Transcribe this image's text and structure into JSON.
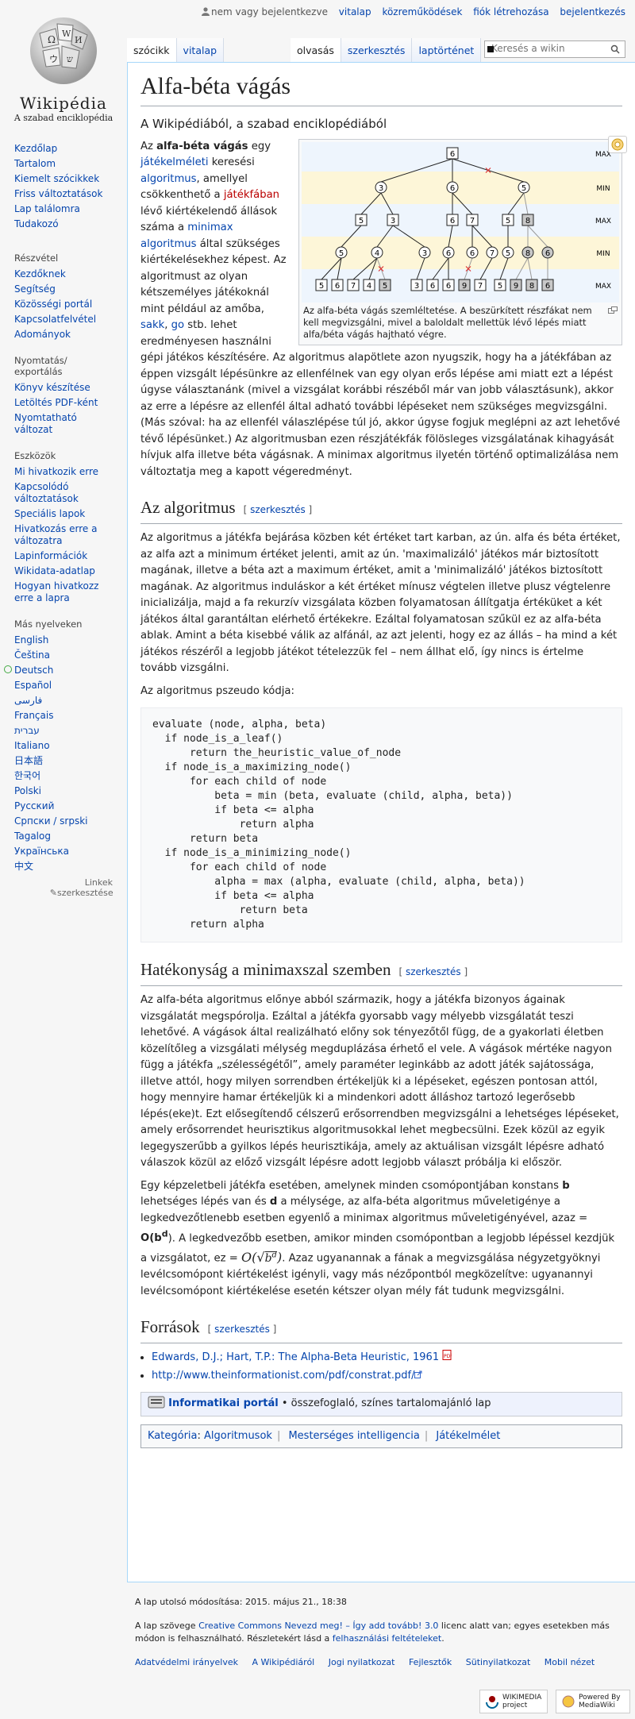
{
  "personal": {
    "not_logged_in": "nem vagy bejelentkezve",
    "talk": "vitalap",
    "contributions": "közreműködések",
    "create_account": "fiók létrehozása",
    "login": "bejelentkezés"
  },
  "logo": {
    "wordmark": "Wikipédia",
    "tagline": "A szabad enciklopédia"
  },
  "tabs": {
    "article": "szócikk",
    "talk": "vitalap",
    "read": "olvasás",
    "edit": "szerkesztés",
    "history": "laptörténet"
  },
  "search": {
    "placeholder": "Keresés a wikin"
  },
  "sidebar": {
    "nav": [
      "Kezdőlap",
      "Tartalom",
      "Kiemelt szócikkek",
      "Friss változtatások",
      "Lap találomra",
      "Tudakozó"
    ],
    "participate_heading": "Részvétel",
    "participate": [
      "Kezdőknek",
      "Segítség",
      "Közösségi portál",
      "Kapcsolatfelvétel",
      "Adományok"
    ],
    "print_heading": "Nyomtatás/ exportálás",
    "print": [
      "Könyv készítése",
      "Letöltés PDF-ként",
      "Nyomtatható változat"
    ],
    "tools_heading": "Eszközök",
    "tools": [
      "Mi hivatkozik erre",
      "Kapcsolódó változtatások",
      "Speciális lapok",
      "Hivatkozás erre a változatra",
      "Lapinformációk",
      "Wikidata-adatlap",
      "Hogyan hivatkozz erre a lapra"
    ],
    "lang_heading": "Más nyelveken",
    "languages": [
      "English",
      "Čeština",
      "Deutsch",
      "Español",
      "فارسی",
      "Français",
      "עברית",
      "Italiano",
      "日本語",
      "한국어",
      "Polski",
      "Русский",
      "Српски / srpski",
      "Tagalog",
      "Українська",
      "中文"
    ],
    "edit_links": "Linkek szerkesztése"
  },
  "article": {
    "title": "Alfa-béta vágás",
    "site_sub": "A Wikipédiából, a szabad enciklopédiából",
    "intro": {
      "t1": "Az ",
      "bold": "alfa-béta vágás",
      "t2": " egy ",
      "l1": "játékelméleti",
      "t3": " keresési ",
      "l2": "algoritmus",
      "t4": ", amellyel csökkenthető a ",
      "l3": "játékfában",
      "t5": " lévő kiértékelendő állások száma a ",
      "l4": "minimax algoritmus",
      "t6": " által szükséges kiértékelésekhez képest. Az algoritmust az olyan kétszemélyes játékoknál mint például az amőba, ",
      "l5": "sakk",
      "t7": ", ",
      "l6": "go",
      "t8": " stb. lehet eredményesen használni gépi játékos készítésére. Az algoritmus alapötlete azon nyugszik, hogy ha a játékfában az éppen vizsgált lépésünkre az ellenfélnek van egy olyan erős lépése ami miatt ezt a lépést úgyse választanánk (mivel a vizsgálat korábbi részéből már van jobb választásunk), akkor az erre a lépésre az ellenfél által adható további lépéseket nem szükséges megvizsgálni. (Más szóval: ha az ellenfél válaszlépése túl jó, akkor úgyse fogjuk meglépni az azt lehetővé tévő lépésünket.) Az algoritmusban ezen rész­játékfák fölösleges vizsgálatának kihagyását hívjuk alfa illetve béta vágásnak. A minimax algoritmus ilyetén történő optimalizálása nem változtatja meg a kapott végeredményt."
    },
    "figure": {
      "caption": "Az alfa-béta vágás szemléltetése. A beszürkített részfákat nem kell megvizsgálni, mivel a baloldalt mellettük lévő lépés miatt alfa/béta vágás hajtható végre.",
      "level_labels": [
        "MAX",
        "MIN",
        "MAX",
        "MIN",
        "MAX"
      ],
      "root": "6",
      "min1": [
        "3",
        "6",
        "5"
      ],
      "max2": [
        "5",
        "3",
        "6",
        "7",
        "5",
        "8"
      ],
      "min3": [
        "5",
        "4",
        "3",
        "6",
        "6",
        "7",
        "5",
        "8",
        "6"
      ],
      "leaves": [
        "5",
        "6",
        "7",
        "4",
        "5",
        "3",
        "6",
        "6",
        "9",
        "7",
        "5",
        "9",
        "8",
        "6"
      ]
    },
    "sec1": {
      "title": "Az algoritmus",
      "edit": "szerkesztés",
      "p1": "Az algoritmus a játékfa bejárása közben két értéket tart karban, az ún. alfa és béta értéket, az alfa azt a minimum értéket jelenti, amit az ún. 'maximalizáló' játékos már biztosított magának, illetve a béta azt a maximum értéket, amit a 'minimalizáló' játékos biztosított magának. Az algoritmus induláskor a két értéket mínusz végtelen illetve plusz végtelenre inicializálja, majd a fa rekurzív vizsgálata közben folyamatosan állítgatja értéküket a két játékos által garantáltan elérhető értékekre. Ezáltal folyamatosan szűkül ez az alfa-béta ablak. Amint a béta kisebbé válik az alfánál, az azt jelenti, hogy ez az állás – ha mind a két játékos részéről a legjobb játékot tételezzük fel – nem állhat elő, így nincs is értelme tovább vizsgálni.",
      "p2": "Az algoritmus pszeudo kódja:",
      "code": "evaluate (node, alpha, beta)\n  if node_is_a_leaf()\n      return the_heuristic_value_of_node\n  if node_is_a_maximizing_node()\n      for each child of node\n          beta = min (beta, evaluate (child, alpha, beta))\n          if beta <= alpha\n              return alpha\n      return beta\n  if node_is_a_minimizing_node()\n      for each child of node\n          alpha = max (alpha, evaluate (child, alpha, beta))\n          if beta <= alpha\n              return beta\n      return alpha"
    },
    "sec2": {
      "title": "Hatékonyság a minimaxszal szemben",
      "edit": "szerkesztés",
      "p1": "Az alfa-béta algoritmus előnye abból származik, hogy a játékfa bizonyos ágainak vizsgálatát megspórolja. Ezáltal a játékfa gyorsabb vagy mélyebb vizsgálatát teszi lehetővé. A vágások által realizálható előny sok tényezőtől függ, de a gyakorlati életben közelítőleg a vizsgálati mélység megduplázása érhető el vele. A vágások mértéke nagyon függ a játékfa „szélességétől”, amely paraméter leginkább az adott játék sajátossága, illetve attól, hogy milyen sorrendben értékeljük ki a lépéseket, egészen pontosan attól, hogy mennyire hamar értékeljük ki a mindenkori adott álláshoz tartozó legerősebb lépés(eke)t. Ezt elősegítendő célszerű erősorrendben megvizsgálni a lehetséges lépéseket, amely erősorrendet heurisztikus algoritmusokkal lehet megbecsülni. Ezek közül az egyik legegyszerűbb a gyilkos lépés heurisztikája, amely az aktuálisan vizsgált lépésre adható válaszok közül az előző vizsgált lépésre adott legjobb választ próbálja ki először.",
      "p2a": "Egy képzeletbeli játékfa esetében, amelynek minden csomópontjában konstans ",
      "b": "b",
      "p2b": " lehetséges lépés van és ",
      "d": "d",
      "p2c": " a mélysége, az alfa-béta algoritmus műveletigénye a legkedvezőtlenebb esetben egyenlő a minimax algoritmus műveletigényével, azaz = ",
      "o_bd": "O(b",
      "p2d": "). A legkedvezőbb esetben, amikor minden csomópontban a legjobb lépéssel kezdjük a vizsgálatot, ez = ",
      "p2e": ". Azaz ugyanannak a fának a megvizsgálása négyzetgyöknyi levélcsomópont kiértékelést igényli, vagy más nézőpontból megközelítve: ugyanannyi levélcsomópont kiértékelése esetén kétszer olyan mély fát tudunk megvizsgálni."
    },
    "sec3": {
      "title": "Források",
      "edit": "szerkesztés",
      "ref1": "Edwards, D.J.; Hart, T.P.: The Alpha-Beta Heuristic, 1961",
      "ref2": "http://www.theinformationist.com/pdf/constrat.pdf/"
    },
    "portal": {
      "link": "Informatikai portál",
      "text": " • összefoglaló, színes tartalomajánló lap"
    },
    "categories": {
      "label": "Kategória",
      "items": [
        "Algoritmusok",
        "Mesterséges intelligencia",
        "Játékelmélet"
      ]
    }
  },
  "footer": {
    "lastmod": "A lap utolsó módosítása: 2015. május 21., 18:38",
    "license_a": "A lap szövege ",
    "license_link": "Creative Commons Nevezd meg! – Így add tovább! 3.0",
    "license_b": " licenc alatt van; egyes esetekben más módon is felhasználható. Részletekért lásd a ",
    "terms_link": "felhasználási feltételeket",
    "license_c": ".",
    "places": [
      "Adatvédelmi irányelvek",
      "A Wikipédiáról",
      "Jogi nyilatkozat",
      "Fejlesztők",
      "Sütinyilatkozat",
      "Mobil nézet"
    ],
    "badge1": "WIKIMEDIA project",
    "badge2": "Powered By MediaWiki"
  },
  "colors": {
    "link": "#0645ad",
    "redlink": "#ba0000",
    "band": "#fdf6d8",
    "pruned": "#c8c8c8"
  }
}
